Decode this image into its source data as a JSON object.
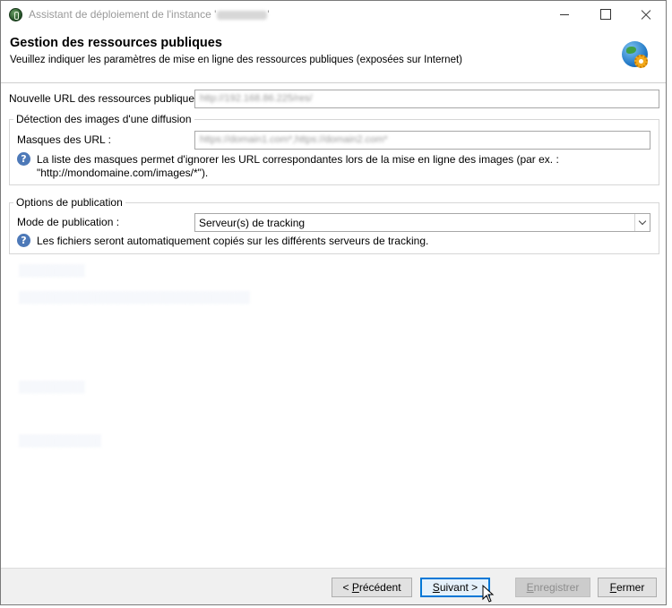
{
  "window": {
    "title_prefix": "Assistant de déploiement de l'instance '",
    "title_suffix": "'"
  },
  "header": {
    "title": "Gestion des ressources publiques",
    "subtitle": "Veuillez indiquer les paramètres de mise en ligne des ressources publiques (exposées sur Internet)"
  },
  "public_url": {
    "label": "Nouvelle URL des ressources publiques :",
    "value": "http://192.168.86.225/res/"
  },
  "image_detection": {
    "legend": "Détection des images d'une diffusion",
    "masks_label": "Masques des URL :",
    "masks_value": "https://domain1.com*,https://domain2.com*",
    "help_line1": "La liste des masques permet d'ignorer les URL correspondantes lors de la mise en ligne des images (par ex. :",
    "help_line2": "\"http://mondomaine.com/images/*\")."
  },
  "publication": {
    "legend": "Options de publication",
    "mode_label": "Mode de publication :",
    "mode_value": "Serveur(s) de tracking",
    "help_text": "Les fichiers seront automatiquement copiés sur les différents serveurs de tracking."
  },
  "footer": {
    "prev": {
      "underlined": "P",
      "rest_before": "< ",
      "rest_after": "récédent"
    },
    "next": {
      "underlined": "S",
      "rest_before": "",
      "rest_after": "uivant >"
    },
    "save": {
      "underlined": "E",
      "rest_before": "",
      "rest_after": "nregistrer"
    },
    "close": {
      "underlined": "F",
      "rest_before": "",
      "rest_after": "ermer"
    }
  },
  "icons": {
    "app": "app-icon",
    "header": "globe-gear-icon",
    "help": "help-icon"
  },
  "colors": {
    "help_icon": "#4d79b8",
    "primary_border": "#0078d7"
  }
}
